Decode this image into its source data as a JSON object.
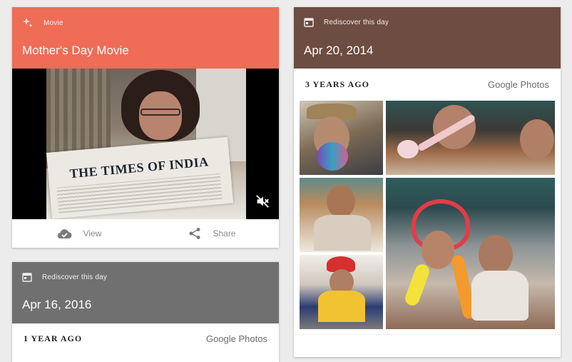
{
  "movie_card": {
    "category": "Movie",
    "title": "Mother's Day Movie",
    "newspaper_text": "THE TIMES OF INDIA",
    "actions": {
      "view": "View",
      "share": "Share"
    },
    "colors": {
      "header": "#ef6c57"
    },
    "icons": {
      "category": "sparkle-icon",
      "view": "cloud-check-icon",
      "share": "share-icon",
      "mute": "volume-off-icon"
    }
  },
  "card_2016": {
    "category": "Rediscover this day",
    "date": "Apr 16, 2016",
    "years_ago": "1 YEAR AGO",
    "brand": "Google Photos",
    "colors": {
      "header": "#707070"
    },
    "icons": {
      "category": "calendar-icon"
    }
  },
  "card_2014": {
    "category": "Rediscover this day",
    "date": "Apr 20, 2014",
    "years_ago": "3 YEARS AGO",
    "brand": "Google Photos",
    "colors": {
      "header": "#6d4c41"
    },
    "icons": {
      "category": "calendar-icon"
    }
  }
}
